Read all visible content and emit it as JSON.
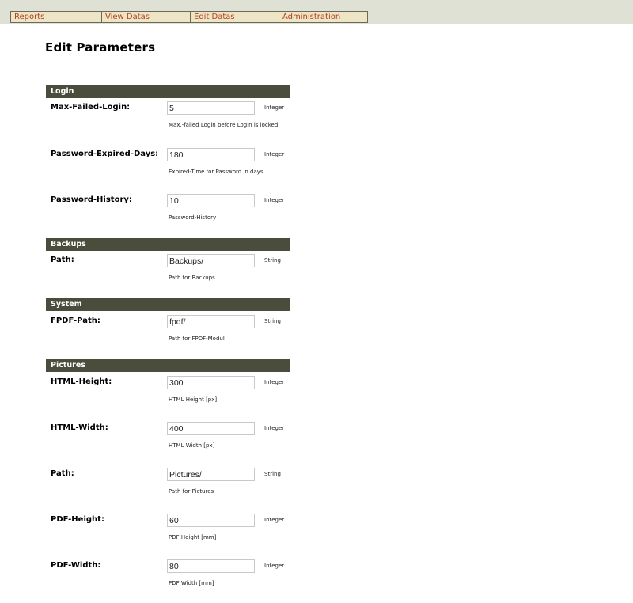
{
  "menu": {
    "items": [
      {
        "label": "Reports"
      },
      {
        "label": "View Datas"
      },
      {
        "label": "Edit Datas"
      },
      {
        "label": "Administration"
      }
    ]
  },
  "colors": {
    "topbar_bg": "#e0e1d5",
    "menu_bg": "#eee4c6",
    "menu_text": "#b4401c",
    "section_bg": "#4a4c3c"
  },
  "page": {
    "title": "Edit Parameters"
  },
  "sections": [
    {
      "title": "Login",
      "params": [
        {
          "label": "Max-Failed-Login:",
          "value": "5",
          "type": "Integer",
          "description": "Max.-failed Login before Login is locked"
        },
        {
          "label": "Password-Expired-Days:",
          "value": "180",
          "type": "Integer",
          "description": "Expired-Time for Password in days"
        },
        {
          "label": "Password-History:",
          "value": "10",
          "type": "Integer",
          "description": "Password-History"
        }
      ]
    },
    {
      "title": "Backups",
      "params": [
        {
          "label": "Path:",
          "value": "Backups/",
          "type": "String",
          "description": "Path for Backups"
        }
      ]
    },
    {
      "title": "System",
      "params": [
        {
          "label": "FPDF-Path:",
          "value": "fpdf/",
          "type": "String",
          "description": "Path for FPDF-Modul"
        }
      ]
    },
    {
      "title": "Pictures",
      "params": [
        {
          "label": "HTML-Height:",
          "value": "300",
          "type": "Integer",
          "description": "HTML Height [px]"
        },
        {
          "label": "HTML-Width:",
          "value": "400",
          "type": "Integer",
          "description": "HTML Width [px]"
        },
        {
          "label": "Path:",
          "value": "Pictures/",
          "type": "String",
          "description": "Path for Pictures"
        },
        {
          "label": "PDF-Height:",
          "value": "60",
          "type": "Integer",
          "description": "PDF Height [mm]"
        },
        {
          "label": "PDF-Width:",
          "value": "80",
          "type": "Integer",
          "description": "PDF Width [mm]"
        }
      ]
    }
  ]
}
